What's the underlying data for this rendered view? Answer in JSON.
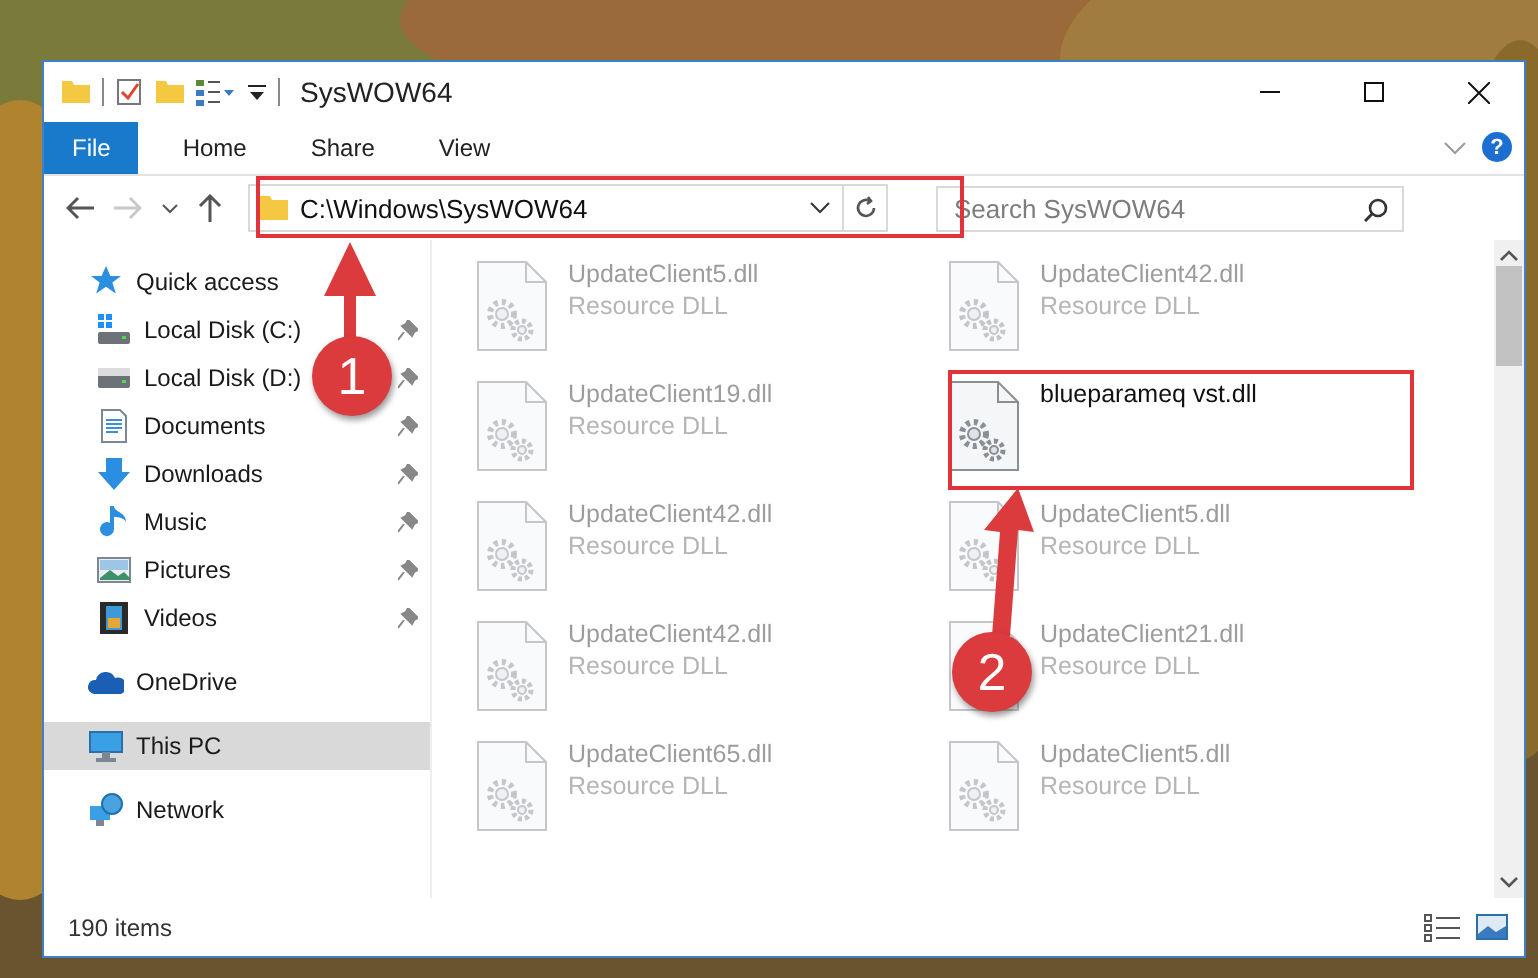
{
  "window": {
    "title": "SysWOW64"
  },
  "ribbon": {
    "tabs": [
      {
        "label": "File",
        "selected": true
      },
      {
        "label": "Home",
        "selected": false
      },
      {
        "label": "Share",
        "selected": false
      },
      {
        "label": "View",
        "selected": false
      }
    ],
    "help": "?"
  },
  "navigation": {
    "back_disabled": false,
    "forward_disabled": true
  },
  "address": {
    "value": "C:\\Windows\\SysWOW64"
  },
  "search": {
    "placeholder": "Search SysWOW64"
  },
  "sidebar": {
    "items": [
      {
        "label": "Quick access",
        "group": true,
        "pinned": false,
        "selected": false
      },
      {
        "label": "Local Disk (C:)",
        "group": false,
        "pinned": true,
        "selected": false
      },
      {
        "label": "Local Disk (D:)",
        "group": false,
        "pinned": true,
        "selected": false
      },
      {
        "label": "Documents",
        "group": false,
        "pinned": true,
        "selected": false
      },
      {
        "label": "Downloads",
        "group": false,
        "pinned": true,
        "selected": false
      },
      {
        "label": "Music",
        "group": false,
        "pinned": true,
        "selected": false
      },
      {
        "label": "Pictures",
        "group": false,
        "pinned": true,
        "selected": false
      },
      {
        "label": "Videos",
        "group": false,
        "pinned": true,
        "selected": false
      },
      {
        "label": "OneDrive",
        "group": true,
        "pinned": false,
        "selected": false
      },
      {
        "label": "This PC",
        "group": true,
        "pinned": false,
        "selected": true
      },
      {
        "label": "Network",
        "group": true,
        "pinned": false,
        "selected": false
      }
    ]
  },
  "files": [
    {
      "name": "UpdateClient5.dll",
      "type": "Resource DLL",
      "blurred": true
    },
    {
      "name": "UpdateClient42.dll",
      "type": "Resource DLL",
      "blurred": true
    },
    {
      "name": "UpdateClient19.dll",
      "type": "Resource DLL",
      "blurred": true
    },
    {
      "name": "blueparameq vst.dll",
      "blurred": false
    },
    {
      "name": "UpdateClient42.dll",
      "type": "Resource DLL",
      "blurred": true
    },
    {
      "name": "UpdateClient5.dll",
      "type": "Resource DLL",
      "blurred": true
    },
    {
      "name": "UpdateClient42.dll",
      "type": "Resource DLL",
      "blurred": true
    },
    {
      "name": "UpdateClient21.dll",
      "type": "Resource DLL",
      "blurred": true
    },
    {
      "name": "UpdateClient65.dll",
      "type": "Resource DLL",
      "blurred": true
    },
    {
      "name": "UpdateClient5.dll",
      "type": "Resource DLL",
      "blurred": true
    }
  ],
  "status_bar": {
    "item_count": "190 items"
  },
  "annotations": [
    {
      "label": "1"
    },
    {
      "label": "2"
    }
  ]
}
